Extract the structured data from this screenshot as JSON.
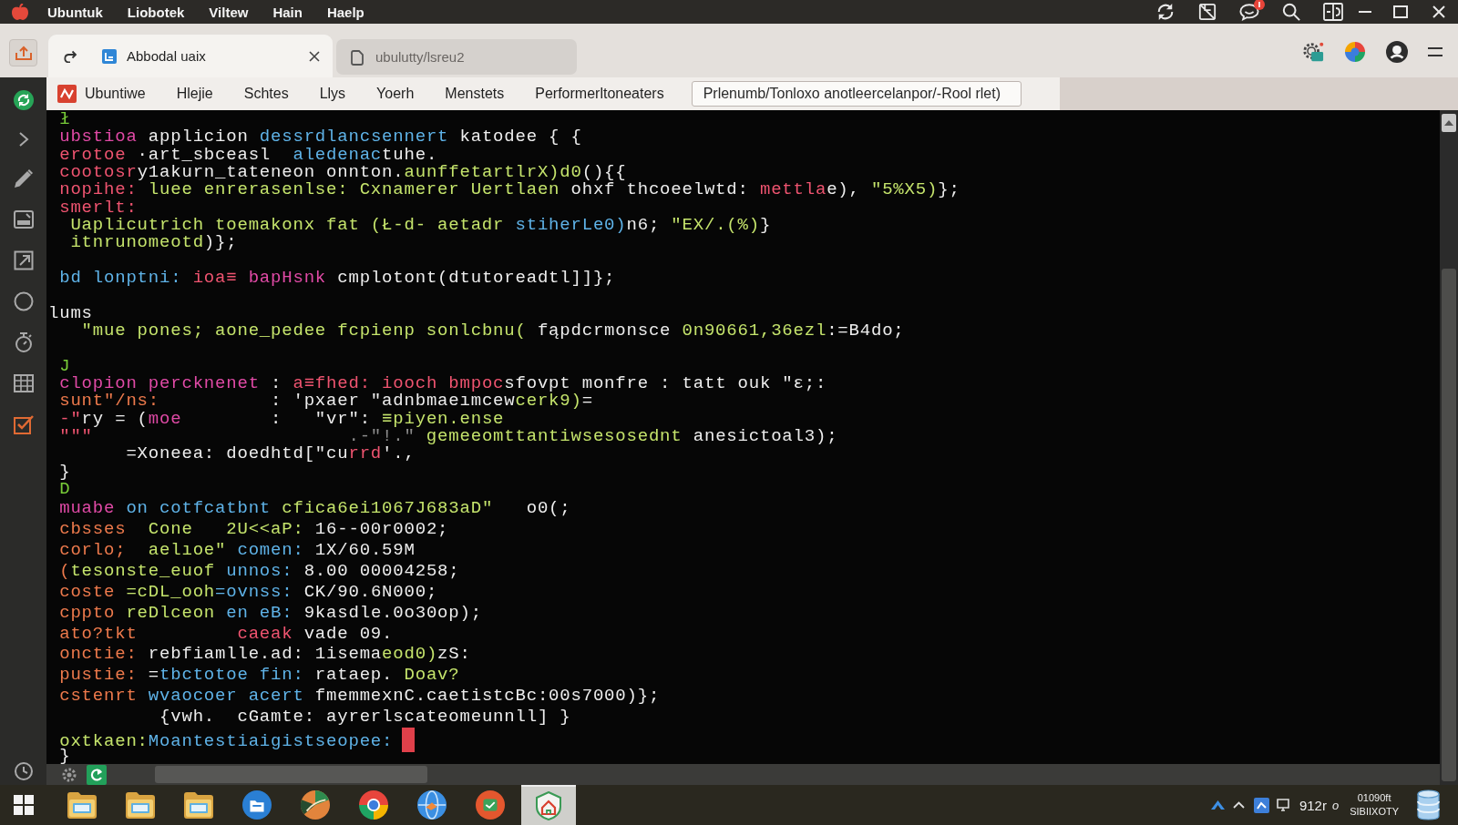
{
  "menu_bar": {
    "items": [
      "Ubuntuk",
      "Liobotek",
      "Viltew",
      "Hain",
      "Haelp"
    ]
  },
  "tabs": [
    {
      "title": "Abbodal uaix",
      "selected": true
    },
    {
      "title": "ubulutty/lsreu2",
      "selected": false
    }
  ],
  "bookmarks": {
    "items": [
      "Ubuntiwe",
      "Hlejie",
      "Schtes",
      "Llys",
      "Yoerh",
      "Menstets",
      "Performerltoneaters"
    ],
    "path_field": {
      "value": "Prlenumb/Tonloxo anotleercelanpor/-Rool rlet)"
    }
  },
  "terminal": {
    "lines": [
      {
        "kind": "code",
        "tokens": [
          {
            "text": " ł",
            "color": "#78cc38"
          }
        ]
      },
      {
        "kind": "code",
        "tokens": [
          {
            "text": " ubstioa",
            "color": "#e04aa6"
          },
          {
            "text": " applicion ",
            "color": "#ededed"
          },
          {
            "text": "dessrdlancsennert",
            "color": "#5fb3e8"
          },
          {
            "text": " katodee { {",
            "color": "#ededed"
          }
        ]
      },
      {
        "kind": "code",
        "tokens": [
          {
            "text": " erotoe",
            "color": "#ef5470"
          },
          {
            "text": " ·art_sbceasl  ",
            "color": "#ededed"
          },
          {
            "text": "aledenac",
            "color": "#5fb3e8"
          },
          {
            "text": "tuhe.",
            "color": "#ededed"
          }
        ]
      },
      {
        "kind": "code",
        "tokens": [
          {
            "text": " cootosr",
            "color": "#ef5470"
          },
          {
            "text": "y1akurn_tateneon onnton.",
            "color": "#ededed"
          },
          {
            "text": "aunffetartlrX)d0",
            "color": "#c5e46c"
          },
          {
            "text": "(){{",
            "color": "#ededed"
          }
        ]
      },
      {
        "kind": "code",
        "tokens": [
          {
            "text": " nopihe:",
            "color": "#ef5470"
          },
          {
            "text": " luee enrerasenlse: Cxnamerer Uertlaen",
            "color": "#c5e46c"
          },
          {
            "text": " ohxf thcoeelwtd: ",
            "color": "#ededed"
          },
          {
            "text": "mettla",
            "color": "#ef5470"
          },
          {
            "text": "e), ",
            "color": "#ededed"
          },
          {
            "text": "\"5%X5)",
            "color": "#c5e46c"
          },
          {
            "text": "};",
            "color": "#ededed"
          }
        ]
      },
      {
        "kind": "code",
        "tokens": [
          {
            "text": " smerlt:",
            "color": "#ef5470"
          }
        ]
      },
      {
        "kind": "code",
        "tokens": [
          {
            "text": "  Uaplicutrich toemakonx fat (Ł-d- aetadr",
            "color": "#c5e46c"
          },
          {
            "text": " stiherLe0)",
            "color": "#5fb3e8"
          },
          {
            "text": "n6; ",
            "color": "#ededed"
          },
          {
            "text": "\"EX/.(%)",
            "color": "#c5e46c"
          },
          {
            "text": "}",
            "color": "#ededed"
          }
        ]
      },
      {
        "kind": "code",
        "tokens": [
          {
            "text": "  itnrunomeotd",
            "color": "#c5e46c"
          },
          {
            "text": ")};",
            "color": "#ededed"
          }
        ]
      },
      {
        "kind": "blank"
      },
      {
        "kind": "code",
        "tokens": [
          {
            "text": " bd lonptni:",
            "color": "#5fb3e8"
          },
          {
            "text": " ioa≡",
            "color": "#ef5470"
          },
          {
            "text": " bapHsnk",
            "color": "#e04aa6"
          },
          {
            "text": " cmplotont(dtutoreadtl]]};",
            "color": "#ededed"
          }
        ]
      },
      {
        "kind": "blank"
      },
      {
        "kind": "code",
        "tokens": [
          {
            "text": "lums",
            "color": "#ededed"
          }
        ]
      },
      {
        "kind": "code",
        "tokens": [
          {
            "text": "   \"mue pones; aone_pedee fcpienp sonlcbnu(",
            "color": "#c5e46c"
          },
          {
            "text": " fąpdcrmonsce ",
            "color": "#ededed"
          },
          {
            "text": "0n90661,36ezl",
            "color": "#c5e46c"
          },
          {
            "text": ":=B4do;",
            "color": "#ededed"
          }
        ]
      },
      {
        "kind": "blank"
      },
      {
        "kind": "code",
        "tokens": [
          {
            "text": " J",
            "color": "#78cc38"
          }
        ]
      },
      {
        "kind": "code",
        "tokens": [
          {
            "text": " clopion percknenet",
            "color": "#e04aa6"
          },
          {
            "text": " : ",
            "color": "#ededed"
          },
          {
            "text": "a≡fhed: iooch bmpoc",
            "color": "#ef5470"
          },
          {
            "text": "sfovpt monfre : tatt ouk \"ɛ;:",
            "color": "#ededed"
          }
        ]
      },
      {
        "kind": "code",
        "tokens": [
          {
            "text": " sunt\"/ns:",
            "color": "#ee7a4c"
          },
          {
            "text": "          : 'pxaer \"adnbmaeımcew",
            "color": "#ededed"
          },
          {
            "text": "cerk9)",
            "color": "#c5e46c"
          },
          {
            "text": "=",
            "color": "#ededed"
          }
        ]
      },
      {
        "kind": "code",
        "tokens": [
          {
            "text": " -\"",
            "color": "#ef5470"
          },
          {
            "text": "ry = (",
            "color": "#ededed"
          },
          {
            "text": "moe",
            "color": "#e04aa6"
          },
          {
            "text": "        :   \"vr\": ",
            "color": "#ededed"
          },
          {
            "text": "≡piyen.ense",
            "color": "#c5e46c"
          }
        ]
      },
      {
        "kind": "code",
        "tokens": [
          {
            "text": " \"\"\"",
            "color": "#ef5470"
          },
          {
            "text": "                       .-\"!.\"",
            "color": "#8c8c8c"
          },
          {
            "text": " gemeeomttantiwsesosednt",
            "color": "#c5e46c"
          },
          {
            "text": " anesictoal3);",
            "color": "#ededed"
          }
        ]
      },
      {
        "kind": "code",
        "tokens": [
          {
            "text": "       =Xoneea: doedhtd[\"cu",
            "color": "#ededed"
          },
          {
            "text": "rrd",
            "color": "#ef5470"
          },
          {
            "text": "'.,",
            "color": "#ededed"
          }
        ]
      },
      {
        "kind": "code",
        "tokens": [
          {
            "text": " }",
            "color": "#ededed"
          }
        ]
      },
      {
        "kind": "code",
        "tokens": [
          {
            "text": " D",
            "color": "#78cc38"
          }
        ]
      },
      {
        "kind": "code",
        "tokens": [
          {
            "text": " muabe",
            "color": "#e04aa6"
          },
          {
            "text": " on cotfcatbnt",
            "color": "#5fb3e8"
          },
          {
            "text": " cfica6ei1067J683aD\"",
            "color": "#c5e46c"
          },
          {
            "text": "   o0(;",
            "color": "#ededed"
          }
        ]
      },
      {
        "kind": "code",
        "tokens": [
          {
            "text": " cbsses",
            "color": "#ee7a4c"
          },
          {
            "text": "  Cone   2U<<aP:",
            "color": "#c5e46c"
          },
          {
            "text": " 16--00r0002;",
            "color": "#ededed"
          }
        ]
      },
      {
        "kind": "code",
        "tokens": [
          {
            "text": " corlo;",
            "color": "#ee7a4c"
          },
          {
            "text": "  aelıoe\"",
            "color": "#c5e46c"
          },
          {
            "text": " comen:",
            "color": "#5fb3e8"
          },
          {
            "text": " 1X/60.59M",
            "color": "#ededed"
          }
        ]
      },
      {
        "kind": "code",
        "tokens": [
          {
            "text": " (",
            "color": "#ee7a4c"
          },
          {
            "text": "tesonste_euof",
            "color": "#c5e46c"
          },
          {
            "text": " unnos:",
            "color": "#5fb3e8"
          },
          {
            "text": " 8.00 00004258;",
            "color": "#ededed"
          }
        ]
      },
      {
        "kind": "code",
        "tokens": [
          {
            "text": " coste",
            "color": "#ee7a4c"
          },
          {
            "text": " =cDL_ooh",
            "color": "#c5e46c"
          },
          {
            "text": "=ovnss:",
            "color": "#5fb3e8"
          },
          {
            "text": " CK/90.6N000;",
            "color": "#ededed"
          }
        ]
      },
      {
        "kind": "code",
        "tokens": [
          {
            "text": " cppto",
            "color": "#ee7a4c"
          },
          {
            "text": " reDlceon",
            "color": "#c5e46c"
          },
          {
            "text": " en eB:",
            "color": "#5fb3e8"
          },
          {
            "text": " 9kasdle.0o30op);",
            "color": "#ededed"
          }
        ]
      },
      {
        "kind": "code",
        "tokens": [
          {
            "text": " ato?tkt",
            "color": "#ee7a4c"
          },
          {
            "text": "         caeak",
            "color": "#ef5470"
          },
          {
            "text": " vade 09.",
            "color": "#ededed"
          }
        ]
      },
      {
        "kind": "code",
        "tokens": [
          {
            "text": " onctie:",
            "color": "#ee7a4c"
          },
          {
            "text": " rebfiamlle.ad: 1isema",
            "color": "#ededed"
          },
          {
            "text": "eod0)",
            "color": "#c5e46c"
          },
          {
            "text": "zS:",
            "color": "#ededed"
          }
        ]
      },
      {
        "kind": "code",
        "tokens": [
          {
            "text": " pustie:",
            "color": "#ee7a4c"
          },
          {
            "text": " =",
            "color": "#ededed"
          },
          {
            "text": "tbctotoe fin:",
            "color": "#5fb3e8"
          },
          {
            "text": " rataep.",
            "color": "#ededed"
          },
          {
            "text": " Doav?",
            "color": "#c5e46c"
          }
        ]
      },
      {
        "kind": "code",
        "tokens": [
          {
            "text": " cstenrt",
            "color": "#ee7a4c"
          },
          {
            "text": " wvaocoer acert",
            "color": "#5fb3e8"
          },
          {
            "text": " fmemmexnC.caetistcBc:00s7000)};",
            "color": "#ededed"
          }
        ]
      },
      {
        "kind": "code",
        "tokens": [
          {
            "text": "          {vwh.  cGamte: ayrerlscateomeunnll] }",
            "color": "#ededed"
          }
        ]
      },
      {
        "kind": "prompt",
        "tokens": [
          {
            "text": " oxtkaen:",
            "color": "#c5e46c"
          },
          {
            "text": "Moantestiaigistseopee:",
            "color": "#5fb3e8"
          }
        ]
      },
      {
        "kind": "code",
        "tokens": [
          {
            "text": " }",
            "color": "#ededed"
          }
        ]
      }
    ]
  },
  "taskbar": {
    "apps": [
      {
        "selected": false
      },
      {
        "selected": false
      },
      {
        "selected": false
      },
      {
        "selected": false
      },
      {
        "selected": false
      },
      {
        "selected": false
      },
      {
        "selected": false
      },
      {
        "selected": false
      },
      {
        "selected": true
      }
    ],
    "tray": {
      "label": "912r",
      "mark": "o",
      "time": "01090ft",
      "date": "SIBIIXOTY"
    }
  }
}
